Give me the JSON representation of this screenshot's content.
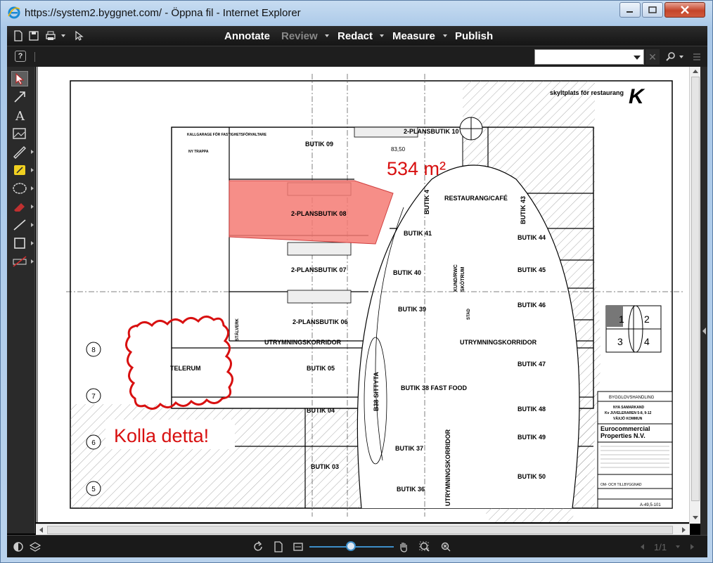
{
  "window": {
    "title": "https://system2.byggnet.com/ - Öppna fil - Internet Explorer"
  },
  "menu": {
    "annotate": "Annotate",
    "review": "Review",
    "redact": "Redact",
    "measure": "Measure",
    "publish": "Publish"
  },
  "search": {
    "value": "",
    "clear_label": "✕"
  },
  "help_label": "?",
  "drawing": {
    "area_label": "534 m²",
    "note_label": "Kolla detta!",
    "top_note": "skyltplats för restaurang",
    "rooms": {
      "butik09": "BUTIK 09",
      "plan10": "2-PLANSBUTIK 10",
      "plan08": "2-PLANSBUTIK 08",
      "plan07": "2-PLANSBUTIK 07",
      "plan06": "2-PLANSBUTIK 06",
      "butik05": "BUTIK 05",
      "butik04": "BUTIK 04",
      "butik03": "BUTIK 03",
      "restaurang": "RESTAURANG/CAFÉ",
      "butik4": "BUTIK 4",
      "butik41": "BUTIK 41",
      "butik40": "BUTIK 40",
      "butik39": "BUTIK 39",
      "butik38": "BUTIK 38 FAST FOOD",
      "butik37": "BUTIK 37",
      "butik36": "BUTIK 36",
      "butik43": "BUTIK 43",
      "butik44": "BUTIK 44",
      "butik45": "BUTIK 45",
      "butik46": "BUTIK 46",
      "butik47": "BUTIK 47",
      "butik48": "BUTIK 48",
      "butik49": "BUTIK 49",
      "butik50": "BUTIK 50",
      "telerum": "TELERUM",
      "sittyta": "B38 SITTYTA",
      "korr1": "UTRYMNINGSKORRIDOR",
      "korr2": "UTRYMNINGSKORRIDOR",
      "korr3": "UTRYMNINGSKORRIDOR",
      "kund": "KUND/RWC",
      "skotrum": "SKÖTRUM",
      "stad": "STAD",
      "stalverk": "STÄLVERK",
      "kallgarage": "KALLGARAGE FÖR FASTIGHETSFÖRVALTARE",
      "nytrappa": "NY TRAPPA",
      "elev": "83,50"
    },
    "axis": [
      "8",
      "7",
      "6",
      "5"
    ],
    "keyplan": [
      "1",
      "2",
      "3",
      "4"
    ],
    "titleblock": {
      "status": "BYGGLOVSHANDLING",
      "project": "NYA SAMARKAND",
      "block": "Kv JUVELERAREN 5-8, 9-12",
      "city": "VÄXJÖ KOMMUN",
      "client": "Eurocommercial Properties N.V.",
      "sheet": "A-49,5-101",
      "desc": "OM- OCH TILLBYGGNAD"
    }
  },
  "bottom": {
    "page_indicator": "1/1"
  },
  "colors": {
    "highlight_fill": "#f47a73",
    "cloud_red": "#d81010",
    "zoom_accent": "#3d8ec9"
  }
}
